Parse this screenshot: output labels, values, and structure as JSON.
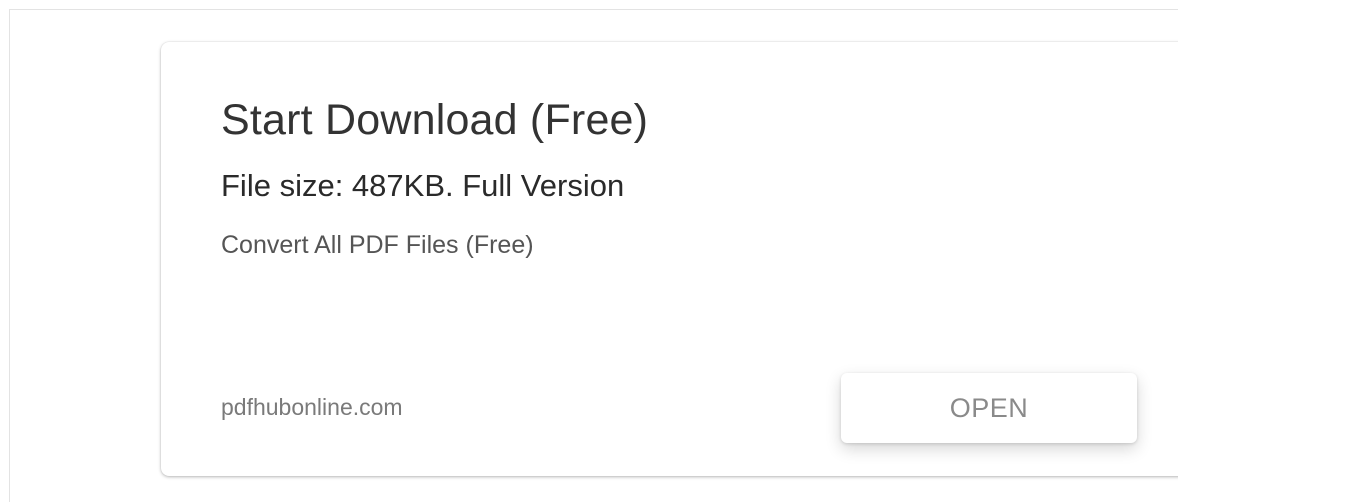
{
  "ad": {
    "headline": "Start Download (Free)",
    "subheadline": "File size: 487KB. Full Version",
    "description": "Convert All PDF Files (Free)",
    "domain": "pdfhubonline.com",
    "cta_label": "OPEN"
  },
  "colors": {
    "background": "#ffffff",
    "headline_text": "#333333",
    "muted_text": "#7a7a7a",
    "button_text": "#8a8a8a"
  }
}
